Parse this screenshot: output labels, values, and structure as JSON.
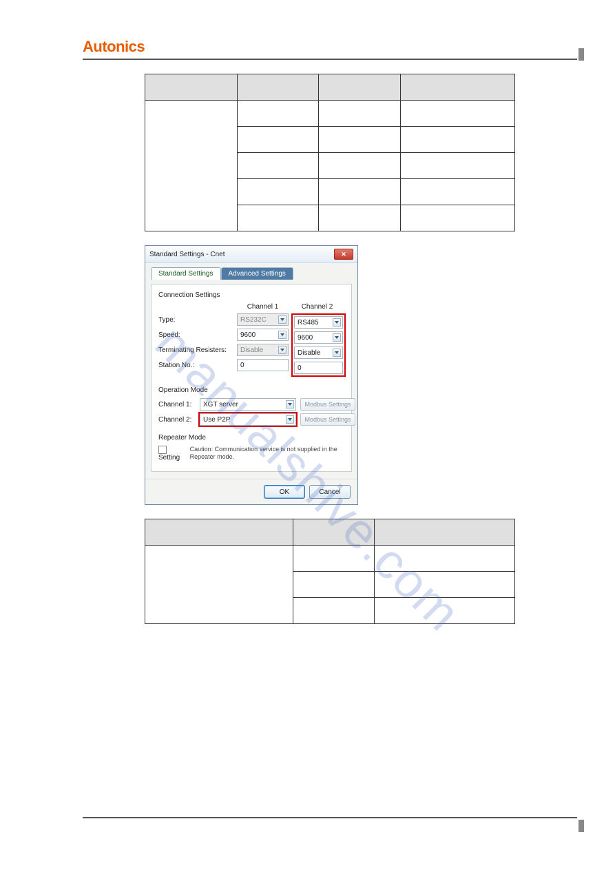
{
  "header": {
    "brand": "Autonics"
  },
  "table1": {
    "headers": [
      "",
      "",
      ""
    ],
    "row_labels": [
      "",
      "",
      "",
      "",
      ""
    ],
    "col_headers": [
      "",
      "",
      ""
    ]
  },
  "dialog": {
    "title": "Standard Settings - Cnet",
    "tabs": {
      "active": "Standard Settings",
      "inactive": "Advanced Settings"
    },
    "connection": {
      "title": "Connection Settings",
      "col1_header": "Channel 1",
      "col2_header": "Channel 2",
      "rows": {
        "type": {
          "label": "Type:",
          "ch1": "RS232C",
          "ch2": "RS485"
        },
        "speed": {
          "label": "Speed:",
          "ch1": "9600",
          "ch2": "9600"
        },
        "term": {
          "label": "Terminating Resisters:",
          "ch1": "Disable",
          "ch2": "Disable"
        },
        "station": {
          "label": "Station No.:",
          "ch1": "0",
          "ch2": "0"
        }
      }
    },
    "operation": {
      "title": "Operation Mode",
      "ch1_label": "Channel 1:",
      "ch1_value": "XGT server",
      "ch2_label": "Channel 2:",
      "ch2_value": "Use P2P",
      "modbus_btn": "Modbus Settings"
    },
    "repeater": {
      "title": "Repeater Mode",
      "setting_label": "Setting",
      "caution": "Caution: Communication service is not supplied in the Repeater mode."
    },
    "buttons": {
      "ok": "OK",
      "cancel": "Cancel"
    }
  },
  "table2": {
    "headers": [
      "",
      ""
    ],
    "rows": [
      "",
      "",
      ""
    ]
  },
  "watermark": "manualshive.com"
}
